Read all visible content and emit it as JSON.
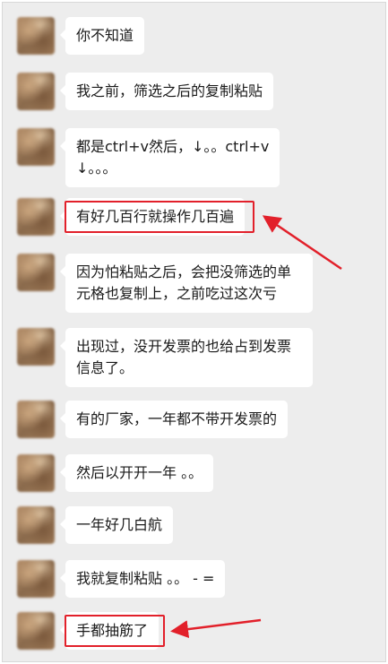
{
  "messages": [
    {
      "text": "你不知道"
    },
    {
      "text": "我之前，筛选之后的复制粘贴"
    },
    {
      "text": "都是ctrl+v然后，↓。。ctrl+v\n↓。。。"
    },
    {
      "text": "有好几百行就操作几百遍"
    },
    {
      "text": "因为怕粘贴之后，会把没筛选的单元格也复制上，之前吃过这次亏"
    },
    {
      "text": "出现过，没开发票的也给占到发票信息了。"
    },
    {
      "text": "有的厂家，一年都不带开发票的"
    },
    {
      "text": "然后以开开一年 。。"
    },
    {
      "text": "一年好几白航"
    },
    {
      "text": "我就复制粘贴 。。 - ="
    },
    {
      "text": "手都抽筋了"
    }
  ],
  "colors": {
    "chat_background": "#ededed",
    "bubble": "#ffffff",
    "highlight": "#e2202a"
  }
}
